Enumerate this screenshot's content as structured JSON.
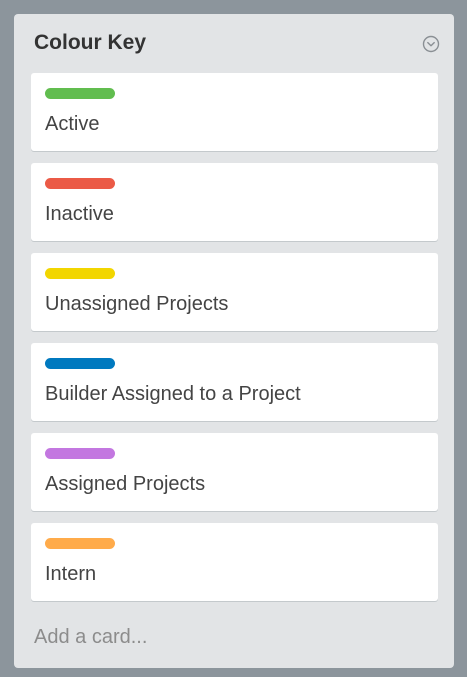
{
  "list": {
    "title": "Colour Key",
    "menu_icon": "chevron-down-circle-icon",
    "cards": [
      {
        "label_color": "#61bd4f",
        "title": "Active"
      },
      {
        "label_color": "#eb5a46",
        "title": "Inactive"
      },
      {
        "label_color": "#f2d600",
        "title": "Unassigned Projects"
      },
      {
        "label_color": "#0079bf",
        "title": "Builder Assigned to a Project"
      },
      {
        "label_color": "#c377e0",
        "title": "Assigned Projects"
      },
      {
        "label_color": "#ffab4a",
        "title": "Intern"
      }
    ],
    "add_card_label": "Add a card..."
  }
}
